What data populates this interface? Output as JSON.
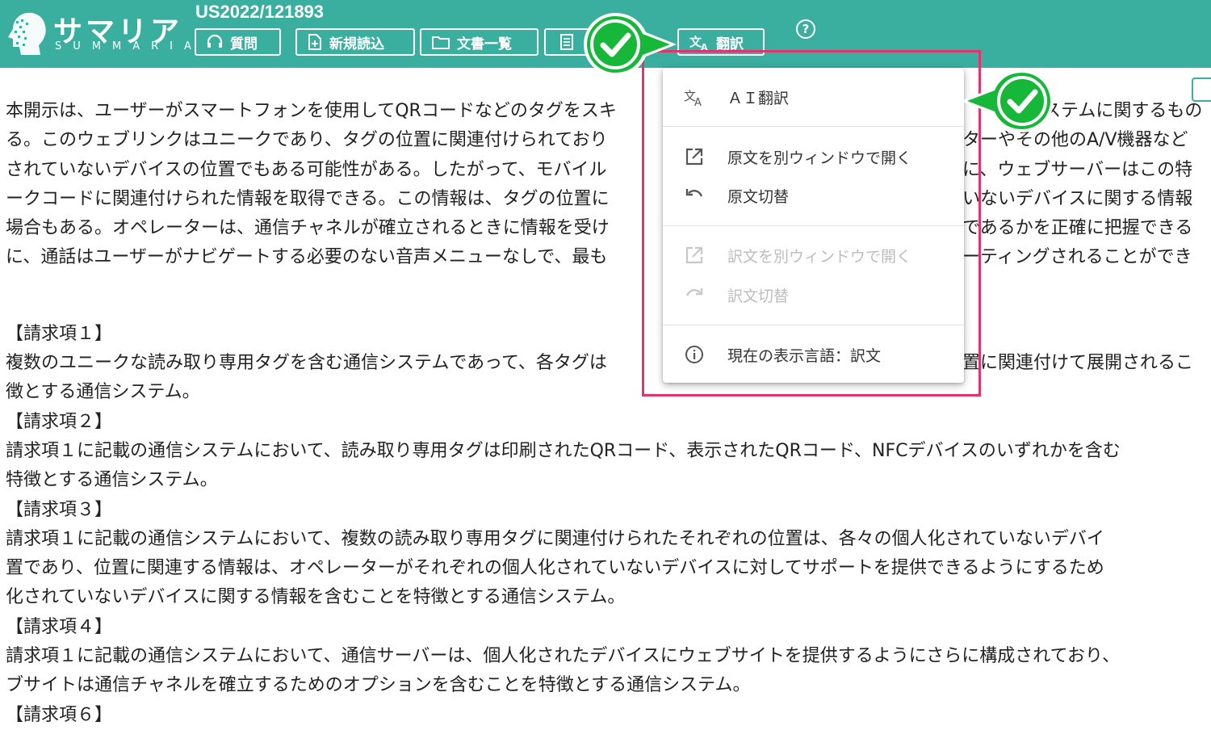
{
  "header": {
    "logo_title": "サマリア",
    "logo_subtitle": "SUMMARIA",
    "document_id": "US2022/121893",
    "buttons": {
      "question": "質問",
      "new_import": "新規読込",
      "document_list": "文書一覧",
      "translate": "翻訳"
    },
    "help_label": "?"
  },
  "menu": {
    "items": {
      "ai_translate": "ＡＩ翻訳",
      "open_original_window": "原文を別ウィンドウで開く",
      "switch_original": "原文切替",
      "open_translation_window": "訳文を別ウィンドウで開く",
      "switch_translation": "訳文切替",
      "current_language": "現在の表示言語：訳文"
    }
  },
  "document": {
    "abstract_lines": [
      "本開示は、ユーザーがスマートフォンを使用してQRコードなどのタグをスキ",
      "る。このウェブリンクはユニークであり、タグの位置に関連付けられており",
      "されていないデバイスの位置でもある可能性がある。したがって、モバイル",
      "ークコードに関連付けられた情報を取得できる。この情報は、タグの位置に",
      "場合もある。オペレーターは、通信チャネルが確立されるときに情報を受け",
      "に、通話はユーザーがナビゲートする必要のない音声メニューなしで、最も"
    ],
    "abstract_right_lines": [
      "ステムに関するもの",
      "ターやその他のA/V機器など",
      "に、ウェブサーバーはこの特",
      "いないデバイスに関する情報",
      "であるかを正確に把握できる",
      "ーティングされることができ"
    ],
    "claim1_heading": "【請求項１】",
    "claim1_lines": [
      "複数のユニークな読み取り専用タグを含む通信システムであって、各タグは",
      "徴とする通信システム。"
    ],
    "claim1_right": "置に関連付けて展開されるこ",
    "claim2_heading": "【請求項２】",
    "claim2_lines": [
      "請求項１に記載の通信システムにおいて、読み取り専用タグは印刷されたQRコード、表示されたQRコード、NFCデバイスのいずれかを含む",
      "特徴とする通信システム。"
    ],
    "claim3_heading": "【請求項３】",
    "claim3_lines": [
      "請求項１に記載の通信システムにおいて、複数の読み取り専用タグに関連付けられたそれぞれの位置は、各々の個人化されていないデバイ",
      "置であり、位置に関連する情報は、オペレーターがそれぞれの個人化されていないデバイスに対してサポートを提供できるようにするため",
      "化されていないデバイスに関する情報を含むことを特徴とする通信システム。"
    ],
    "claim4_heading": "【請求項４】",
    "claim4_lines": [
      "請求項１に記載の通信システムにおいて、通信サーバーは、個人化されたデバイスにウェブサイトを提供するようにさらに構成されており、",
      "ブサイトは通信チャネルを確立するためのオプションを含むことを特徴とする通信システム。"
    ],
    "claim6_heading": "【請求項６】"
  },
  "colors": {
    "header_bg": "#3aaf9f",
    "highlight_border": "#e2336f",
    "check_green": "#17b83a"
  },
  "icons": {
    "question": "headset-icon",
    "new_import": "file-plus-icon",
    "document_list": "folder-icon",
    "summary": "document-icon",
    "translate": "translate-icon",
    "help": "help-circle-icon"
  }
}
